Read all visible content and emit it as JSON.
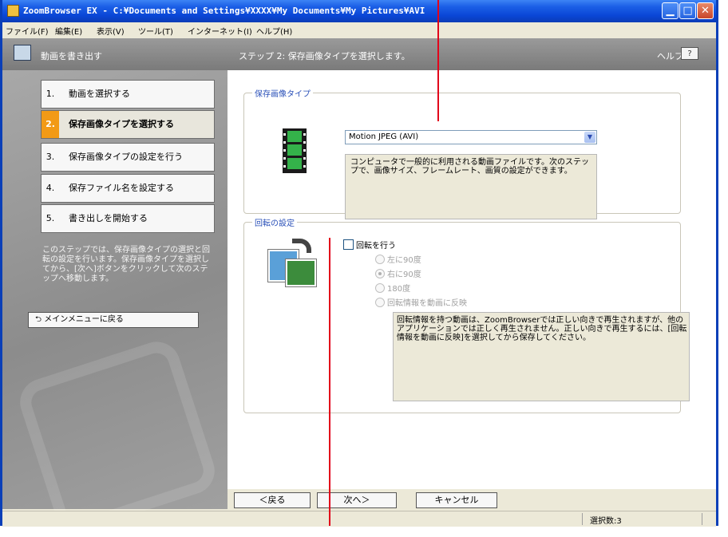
{
  "window": {
    "title": "ZoomBrowser EX - C:¥Documents and Settings¥XXXX¥My Documents¥My Pictures¥AVI"
  },
  "menubar": {
    "items": [
      "ファイル(F)",
      "編集(E)",
      "表示(V)",
      "ツール(T)",
      "インターネット(I)",
      "ヘルプ(H)"
    ]
  },
  "header": {
    "title": "動画を書き出す",
    "step_text": "ステップ 2: 保存画像タイプを選択します。",
    "help_label": "ヘルプ",
    "help_button": "?"
  },
  "steps": [
    {
      "num": "1.",
      "label": "動画を選択する",
      "active": false
    },
    {
      "num": "2.",
      "label": "保存画像タイプを選択する",
      "active": true
    },
    {
      "num": "3.",
      "label": "保存画像タイプの設定を行う",
      "active": false
    },
    {
      "num": "4.",
      "label": "保存ファイル名を設定する",
      "active": false
    },
    {
      "num": "5.",
      "label": "書き出しを開始する",
      "active": false
    }
  ],
  "left": {
    "description": "このステップでは、保存画像タイプの選択と回転の設定を行います。保存画像タイプを選択してから、[次へ]ボタンをクリックして次のステップへ移動します。",
    "main_menu_button": "メインメニューに戻る"
  },
  "save_type": {
    "group_label": "保存画像タイプ",
    "selected": "Motion JPEG (AVI)",
    "description": "コンピュータで一般的に利用される動画ファイルです。次のステップで、画像サイズ、フレームレート、画質の設定ができます。"
  },
  "rotation": {
    "group_label": "回転の設定",
    "checkbox_label": "回転を行う",
    "checked": false,
    "options": [
      {
        "label": "左に90度",
        "selected": false
      },
      {
        "label": "右に90度",
        "selected": true
      },
      {
        "label": "180度",
        "selected": false
      },
      {
        "label": "回転情報を動画に反映",
        "selected": false
      }
    ],
    "description": "回転情報を持つ動画は、ZoomBrowserでは正しい向きで再生されますが、他のアプリケーションでは正しく再生されません。正しい向きで再生するには、[回転情報を動画に反映]を選択してから保存してください。"
  },
  "nav": {
    "back": "＜戻る",
    "next": "次へ＞",
    "cancel": "キャンセル"
  },
  "status": {
    "selection_count": "選択数:3"
  },
  "colors": {
    "accent_orange": "#f29a16",
    "callout_red": "#e2001a",
    "group_label_blue": "#2a50b8"
  }
}
